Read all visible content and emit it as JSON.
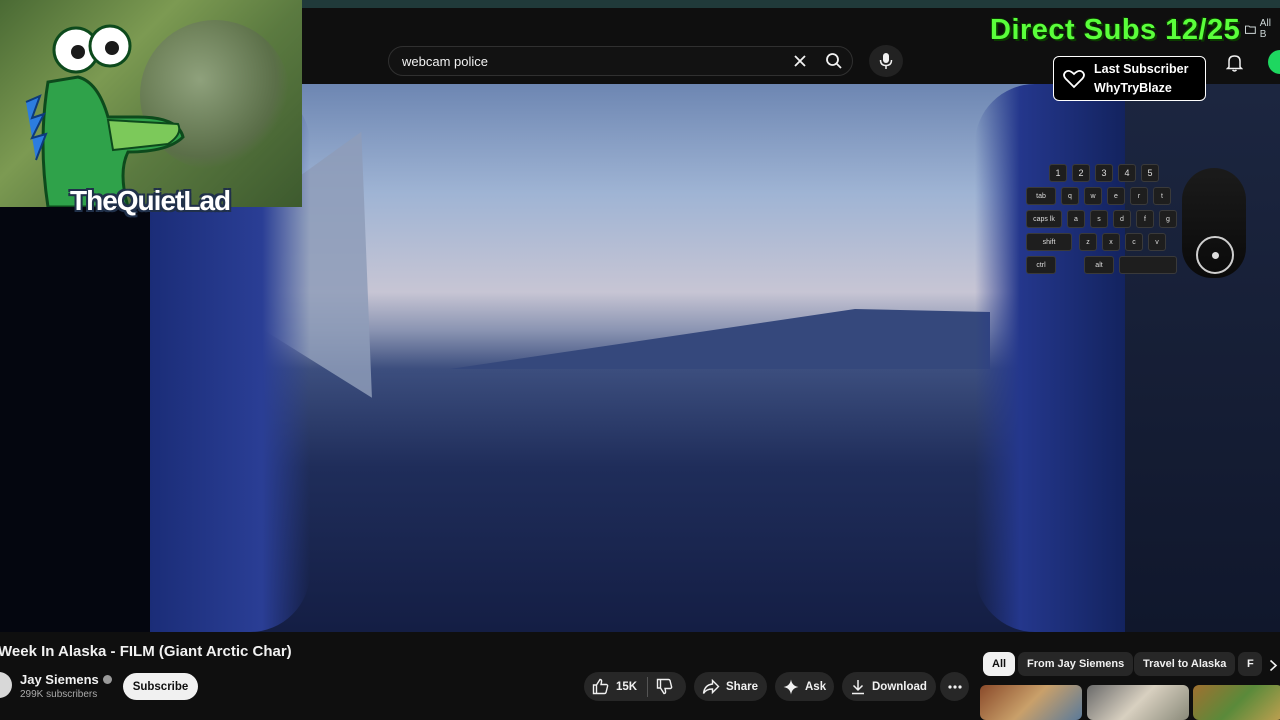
{
  "browser": {
    "bookmarks_label": "All B"
  },
  "search": {
    "value": "webcam police",
    "placeholder": "Search"
  },
  "overlay": {
    "direct_subs": "Direct Subs 12/25",
    "last_subscriber_label": "Last Subscriber",
    "last_subscriber_name": "WhyTryBlaze",
    "webcam_name": "TheQuietLad"
  },
  "keyboard": {
    "number_keys": [
      "1",
      "2",
      "3",
      "4",
      "5"
    ],
    "row_tab": [
      "tab",
      "q",
      "w",
      "e",
      "r",
      "t"
    ],
    "row_caps": [
      "caps lk",
      "a",
      "s",
      "d",
      "f",
      "g"
    ],
    "row_shift": [
      "shift",
      "z",
      "x",
      "c",
      "v"
    ],
    "row_ctrl": [
      "ctrl",
      "alt"
    ]
  },
  "video": {
    "title": "Week In Alaska - FILM (Giant Arctic Char)",
    "channel_name": "Jay Siemens",
    "subscribers": "299K subscribers",
    "subscribe_label": "Subscribe",
    "likes": "15K",
    "share_label": "Share",
    "ask_label": "Ask",
    "download_label": "Download"
  },
  "chips": [
    "All",
    "From Jay Siemens",
    "Travel to Alaska",
    "F"
  ],
  "colors": {
    "overlay_green": "#5aff3b",
    "accent_online": "#1ed760"
  }
}
